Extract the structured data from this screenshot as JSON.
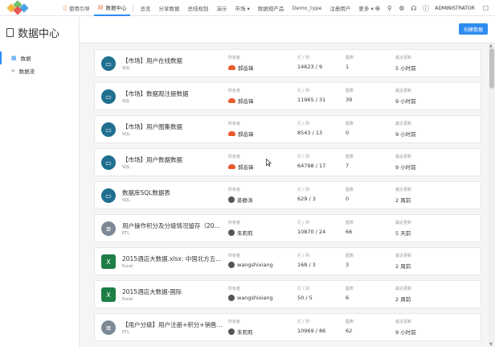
{
  "nav": {
    "items": [
      {
        "label": "使用引导",
        "icon": "book-icon"
      },
      {
        "label": "数据中心",
        "icon": "doc-icon",
        "active": true
      },
      {
        "label": "总览"
      },
      {
        "label": "分享数据"
      },
      {
        "label": "总结规划"
      },
      {
        "label": "演示"
      },
      {
        "label": "市场 ▾"
      },
      {
        "label": "数据观产品"
      },
      {
        "label": "Demo_type"
      },
      {
        "label": "注册用户"
      },
      {
        "label": "更多 ▾"
      }
    ],
    "user": "ADMINISTRATOR"
  },
  "sidebar": {
    "title": "数据中心",
    "items": [
      {
        "label": "数据",
        "icon": "table-icon"
      },
      {
        "label": "数据流",
        "icon": "flow-icon"
      }
    ]
  },
  "main": {
    "create_button": "创建数据",
    "columns": {
      "owner": "所有者",
      "rows": "行 / 列",
      "charts": "图表",
      "updated": "最近更新"
    },
    "cards": [
      {
        "name": "【市场】用户在线数据",
        "type": "SQL",
        "kind": "sql",
        "owner": "郝岳锋",
        "owner_icon": "cloud",
        "rows": "14623 / 9",
        "charts": "1",
        "updated": "5 小时前"
      },
      {
        "name": "【市场】数据观注册数据",
        "type": "SQL",
        "kind": "sql",
        "owner": "郝岳锋",
        "owner_icon": "cloud",
        "rows": "11965 / 31",
        "charts": "39",
        "updated": "9 小时前"
      },
      {
        "name": "【市场】用户图集数据",
        "type": "SQL",
        "kind": "sql",
        "owner": "郝岳锋",
        "owner_icon": "cloud",
        "rows": "8543 / 13",
        "charts": "0",
        "updated": "9 小时前"
      },
      {
        "name": "【市场】用户数据数据",
        "type": "SQL",
        "kind": "sql",
        "owner": "郝岳锋",
        "owner_icon": "cloud",
        "rows": "64798 / 17",
        "charts": "7",
        "updated": "9 小时前"
      },
      {
        "name": "数据库SQL数据表",
        "type": "SQL",
        "kind": "sql",
        "owner": "姜静涛",
        "owner_icon": "avatar",
        "rows": "629 / 3",
        "charts": "0",
        "updated": "2 周前"
      },
      {
        "name": "用户操作积分及分级情况留存（20...",
        "type": "ETL",
        "kind": "etl",
        "owner": "朱莉莉",
        "owner_icon": "avatar",
        "rows": "10870 / 24",
        "charts": "66",
        "updated": "5 天前"
      },
      {
        "name": "2015酒店大数据.xlsx: 中国北方五...",
        "type": "Excel",
        "kind": "excel",
        "owner": "wangshixiang",
        "owner_icon": "avatar",
        "rows": "168 / 3",
        "charts": "3",
        "updated": "2 周前"
      },
      {
        "name": "2015酒店大数据-国际",
        "type": "Excel",
        "kind": "excel",
        "owner": "wangshixiang",
        "owner_icon": "avatar",
        "rows": "50 / 5",
        "charts": "6",
        "updated": "2 周前"
      },
      {
        "name": "【用户分级】用户注册+积分+销售...",
        "type": "ETL",
        "kind": "etl",
        "owner": "朱莉莉",
        "owner_icon": "avatar",
        "rows": "10969 / 86",
        "charts": "62",
        "updated": "9 小时前"
      }
    ]
  }
}
